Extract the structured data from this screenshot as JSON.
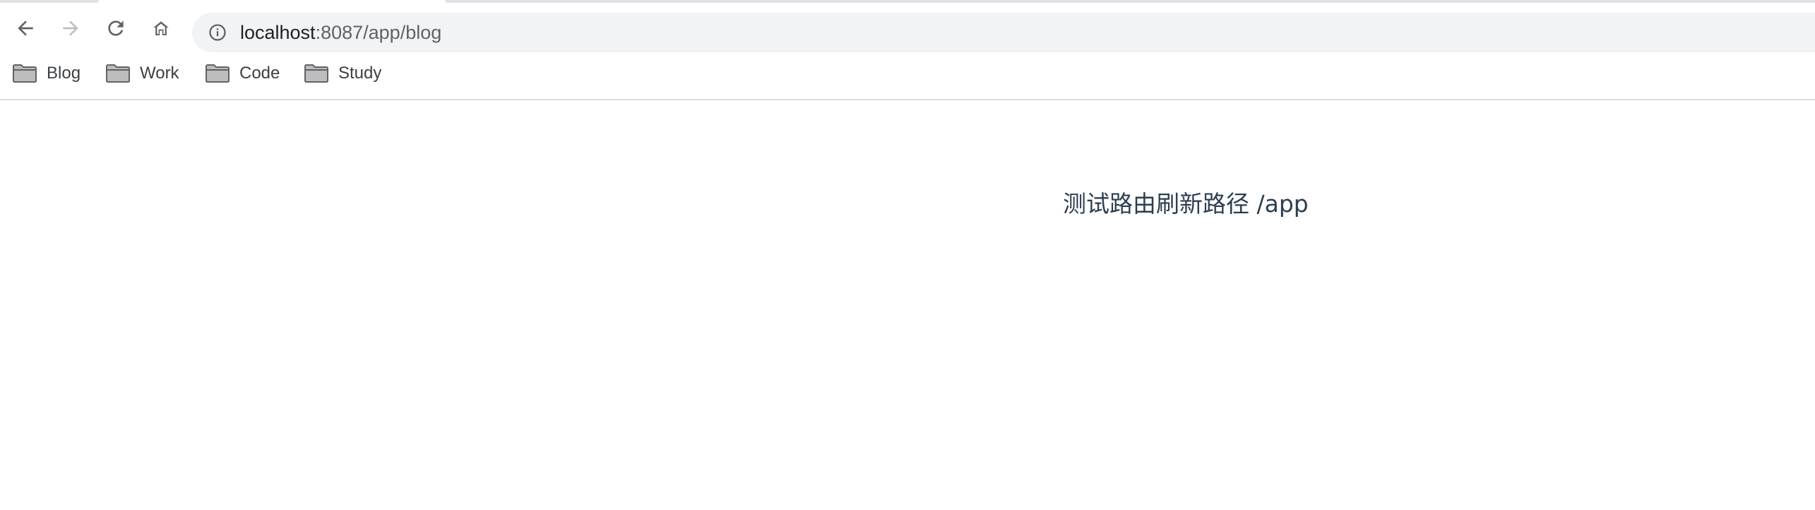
{
  "browser": {
    "address_bar": {
      "host": "localhost",
      "rest": ":8087/app/blog",
      "info_icon": "info-icon"
    },
    "nav": {
      "back_icon": "back-arrow-icon",
      "forward_icon": "forward-arrow-icon",
      "reload_icon": "reload-icon",
      "home_icon": "home-icon"
    },
    "bookmarks": [
      {
        "label": "Blog",
        "icon": "folder-icon"
      },
      {
        "label": "Work",
        "icon": "folder-icon"
      },
      {
        "label": "Code",
        "icon": "folder-icon"
      },
      {
        "label": "Study",
        "icon": "folder-icon"
      }
    ]
  },
  "page": {
    "route_text": "测试路由刷新路径 /app"
  },
  "colors": {
    "text_primary": "#2c3e50",
    "omnibox_bg": "#f1f3f4",
    "divider": "#dadce0"
  }
}
